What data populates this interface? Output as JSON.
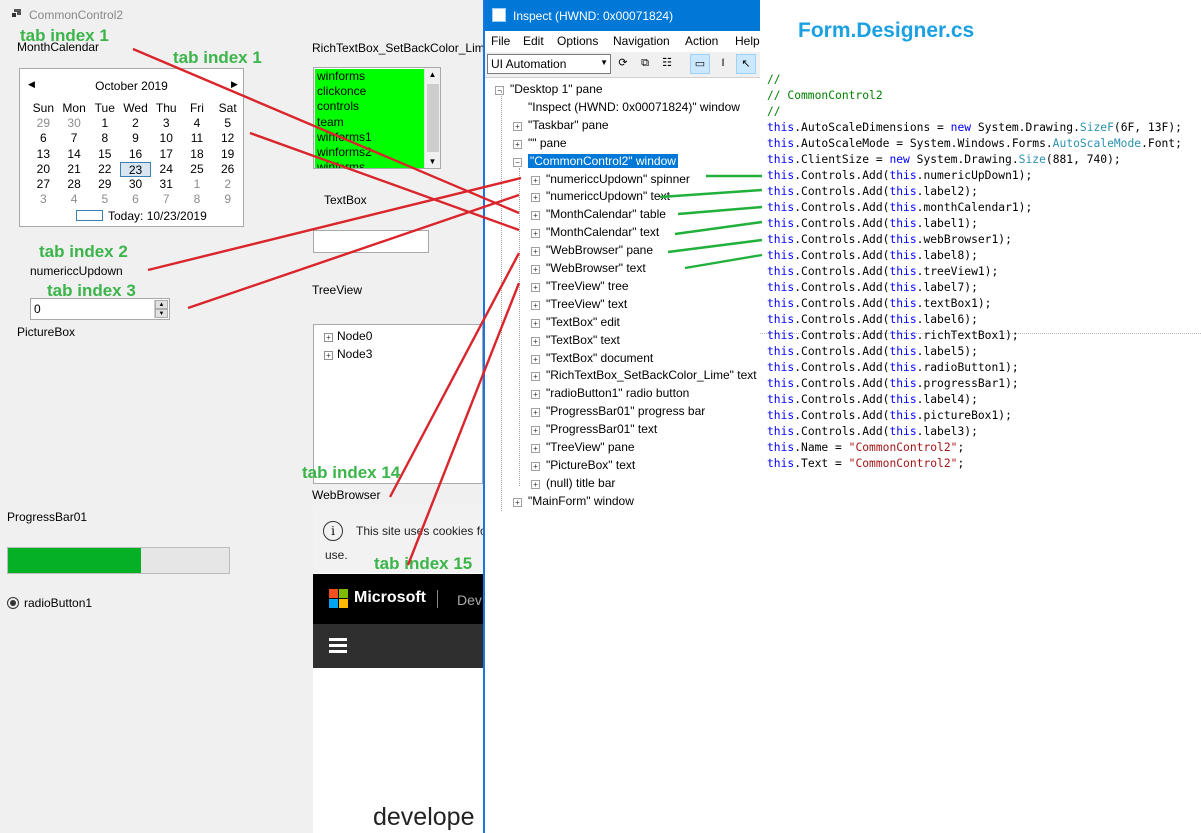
{
  "form": {
    "title": "CommonControl2",
    "month_calendar_label": "MonthCalendar",
    "rich_textbox_label": "RichTextBox_SetBackColor_Lime",
    "rich_textbox_lines": [
      "winforms",
      "clickonce",
      "controls",
      "team",
      "winforms1",
      "winforms2",
      "winforms"
    ],
    "textbox_label": "TextBox",
    "numeric_label": "numericcUpdown",
    "numeric_value": "0",
    "picturebox_label": "PictureBox",
    "treeview_label": "TreeView",
    "tree_nodes": [
      "Node0",
      "Node3"
    ],
    "webbrowser_label": "WebBrowser",
    "progress_label": "ProgressBar01",
    "progress_fraction": 0.6,
    "radio_label": "radioButton1"
  },
  "calendar": {
    "month": "October 2019",
    "days": [
      "Sun",
      "Mon",
      "Tue",
      "Wed",
      "Thu",
      "Fri",
      "Sat"
    ],
    "weeks": [
      [
        "29",
        "30",
        "1",
        "2",
        "3",
        "4",
        "5"
      ],
      [
        "6",
        "7",
        "8",
        "9",
        "10",
        "11",
        "12"
      ],
      [
        "13",
        "14",
        "15",
        "16",
        "17",
        "18",
        "19"
      ],
      [
        "20",
        "21",
        "22",
        "23",
        "24",
        "25",
        "26"
      ],
      [
        "27",
        "28",
        "29",
        "30",
        "31",
        "1",
        "2"
      ],
      [
        "3",
        "4",
        "5",
        "6",
        "7",
        "8",
        "9"
      ]
    ],
    "today": "Today: 10/23/2019"
  },
  "web": {
    "cookie_text": "This site uses cookies fo",
    "cookie_text2": "use.",
    "brand": "Microsoft",
    "nav": "Dev",
    "footer": "develope"
  },
  "annotations": {
    "tab1a": "tab index 1",
    "tab1b": "tab index 1",
    "tab2": "tab index 2",
    "tab3": "tab index 3",
    "tab14": "tab index 14",
    "tab15": "tab index 15",
    "file": "Form.Designer.cs"
  },
  "inspect": {
    "title": "Inspect  (HWND: 0x00071824)",
    "menus": [
      "File",
      "Edit",
      "Options",
      "Navigation",
      "Action",
      "Help"
    ],
    "mode": "UI Automation",
    "tree": [
      {
        "label": "\"Desktop 1\" pane",
        "exp": "−"
      },
      {
        "label": "\"Inspect  (HWND: 0x00071824)\" window",
        "exp": ""
      },
      {
        "label": "\"Taskbar\" pane",
        "exp": "+"
      },
      {
        "label": "\"\" pane",
        "exp": "+"
      },
      {
        "label": "\"CommonControl2\" window",
        "exp": "−"
      },
      {
        "label": "\"numericcUpdown\" spinner",
        "exp": "+"
      },
      {
        "label": "\"numericcUpdown\" text",
        "exp": "+"
      },
      {
        "label": "\"MonthCalendar\" table",
        "exp": "+"
      },
      {
        "label": "\"MonthCalendar\" text",
        "exp": "+"
      },
      {
        "label": "\"WebBrowser\" pane",
        "exp": "+"
      },
      {
        "label": "\"WebBrowser\" text",
        "exp": "+"
      },
      {
        "label": "\"TreeView\" tree",
        "exp": "+"
      },
      {
        "label": "\"TreeView\" text",
        "exp": "+"
      },
      {
        "label": "\"TextBox\" edit",
        "exp": "+"
      },
      {
        "label": "\"TextBox\" text",
        "exp": "+"
      },
      {
        "label": "\"TextBox\" document",
        "exp": "+"
      },
      {
        "label": "\"RichTextBox_SetBackColor_Lime\" text",
        "exp": "+"
      },
      {
        "label": "\"radioButton1\" radio button",
        "exp": "+"
      },
      {
        "label": "\"ProgressBar01\" progress bar",
        "exp": "+"
      },
      {
        "label": "\"ProgressBar01\" text",
        "exp": "+"
      },
      {
        "label": "\"TreeView\" pane",
        "exp": "+"
      },
      {
        "label": "\"PictureBox\" text",
        "exp": "+"
      },
      {
        "label": "(null) title bar",
        "exp": "+"
      },
      {
        "label": "\"MainForm\" window",
        "exp": "+"
      }
    ]
  },
  "code": [
    "//",
    "// CommonControl2",
    "//",
    "this.AutoScaleDimensions = new System.Drawing.SizeF(6F, 13F);",
    "this.AutoScaleMode = System.Windows.Forms.AutoScaleMode.Font;",
    "this.ClientSize = new System.Drawing.Size(881, 740);",
    "this.Controls.Add(this.numericUpDown1);",
    "this.Controls.Add(this.label2);",
    "this.Controls.Add(this.monthCalendar1);",
    "this.Controls.Add(this.label1);",
    "this.Controls.Add(this.webBrowser1);",
    "this.Controls.Add(this.label8);",
    "this.Controls.Add(this.treeView1);",
    "this.Controls.Add(this.label7);",
    "this.Controls.Add(this.textBox1);",
    "this.Controls.Add(this.label6);",
    "this.Controls.Add(this.richTextBox1);",
    "this.Controls.Add(this.label5);",
    "this.Controls.Add(this.radioButton1);",
    "this.Controls.Add(this.progressBar1);",
    "this.Controls.Add(this.label4);",
    "this.Controls.Add(this.pictureBox1);",
    "this.Controls.Add(this.label3);",
    "this.Name = \"CommonControl2\";",
    "this.Text = \"CommonControl2\";"
  ],
  "colors": {
    "green_label": "#3bb54a",
    "red_arrow": "#d9252b",
    "green_arrow": "#21b03b",
    "lime": "#00ff00",
    "progress": "#06b025",
    "file_title": "#1ba1e2"
  }
}
